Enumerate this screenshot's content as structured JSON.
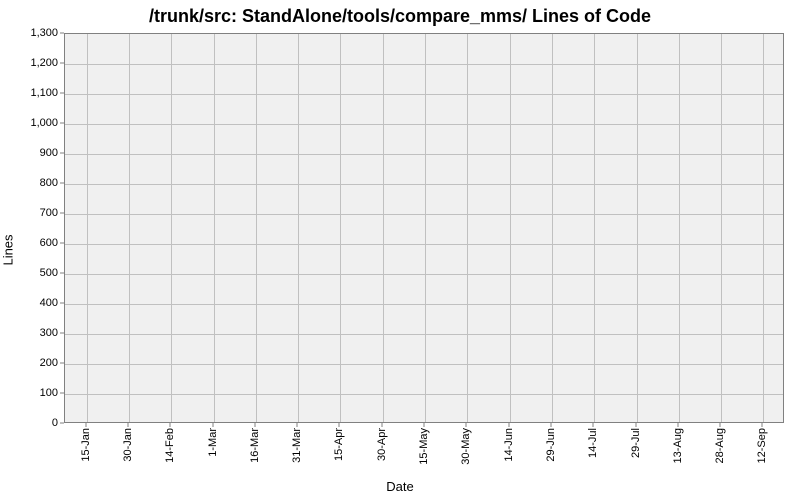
{
  "chart_data": {
    "type": "line",
    "title": "/trunk/src: StandAlone/tools/compare_mms/ Lines of Code",
    "xlabel": "Date",
    "ylabel": "Lines",
    "x_categories": [
      "15-Jan",
      "30-Jan",
      "14-Feb",
      "1-Mar",
      "16-Mar",
      "31-Mar",
      "15-Apr",
      "30-Apr",
      "15-May",
      "30-May",
      "14-Jun",
      "29-Jun",
      "14-Jul",
      "29-Jul",
      "13-Aug",
      "28-Aug",
      "12-Sep"
    ],
    "y_ticks": [
      0,
      100,
      200,
      300,
      400,
      500,
      600,
      700,
      800,
      900,
      1000,
      1100,
      1200,
      1300
    ],
    "ylim": [
      0,
      1300
    ],
    "series": [
      {
        "name": "Lines of Code",
        "values": null
      }
    ],
    "grid": true,
    "legend": false
  }
}
